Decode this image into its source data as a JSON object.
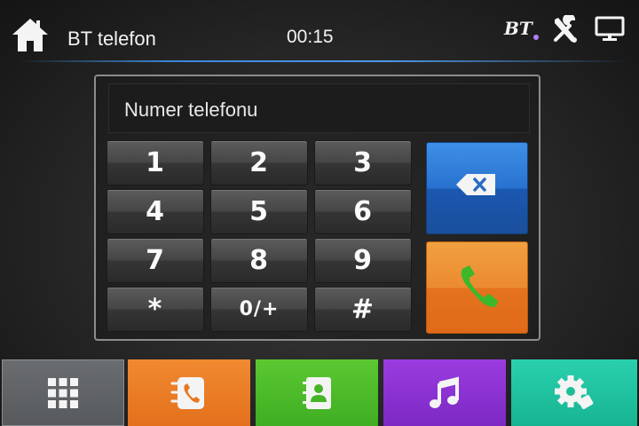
{
  "header": {
    "title": "BT telefon",
    "clock": "00:15",
    "bt_label": "BT",
    "icons": {
      "home": "home-icon",
      "tools": "tools-icon",
      "display": "monitor-icon"
    }
  },
  "dialer": {
    "number_placeholder": "Numer telefonu",
    "keys": [
      "1",
      "2",
      "3",
      "4",
      "5",
      "6",
      "7",
      "8",
      "9",
      "*",
      "0/+",
      "#"
    ],
    "delete_icon": "backspace-icon",
    "call_icon": "phone-handset-icon"
  },
  "tabs": [
    {
      "icon": "keypad-grid-icon",
      "color": "#5f6265"
    },
    {
      "icon": "call-log-icon",
      "color": "#ea7d26"
    },
    {
      "icon": "contacts-book-icon",
      "color": "#4cbb2a"
    },
    {
      "icon": "music-note-icon",
      "color": "#8b32d2"
    },
    {
      "icon": "settings-gear-icon",
      "color": "#20c29f"
    }
  ],
  "colors": {
    "accent_line": "#3a86d8",
    "delete_button": "#2872cf",
    "call_button": "#ec8a30",
    "call_icon": "#3cb82a"
  }
}
